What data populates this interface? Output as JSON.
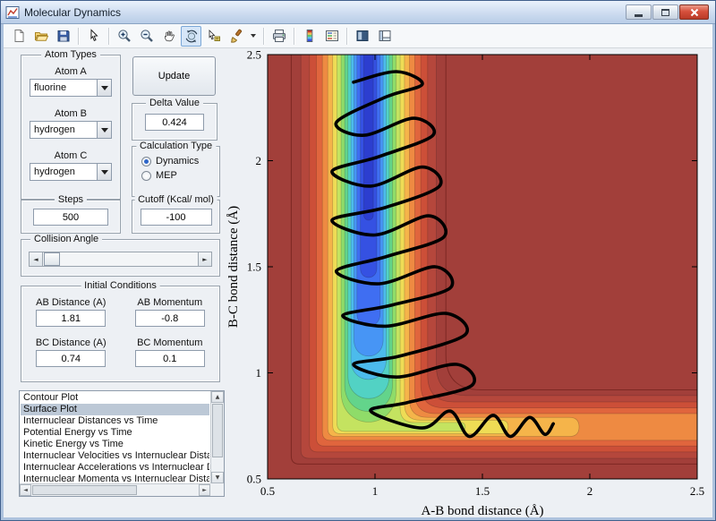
{
  "window": {
    "title": "Molecular Dynamics",
    "controls": [
      "minimize",
      "maximize",
      "close"
    ]
  },
  "toolbar": {
    "icons": [
      "new-figure",
      "open-file",
      "save-figure",
      "edit-plot",
      "zoom-in",
      "zoom-out",
      "pan",
      "rotate-3d",
      "data-cursor",
      "brush",
      "brush-dropdown",
      "print-figure",
      "insert-colorbar",
      "insert-legend",
      "hide-plot-tools",
      "show-plot-tools"
    ],
    "active_icon": "rotate-3d"
  },
  "panels": {
    "atom_types": {
      "title": "Atom Types",
      "fields": [
        {
          "label": "Atom A",
          "value": "fluorine"
        },
        {
          "label": "Atom B",
          "value": "hydrogen"
        },
        {
          "label": "Atom C",
          "value": "hydrogen"
        }
      ]
    },
    "update_button": {
      "label": "Update"
    },
    "delta": {
      "title": "Delta Value",
      "value": "0.424"
    },
    "calculation_type": {
      "title": "Calculation Type",
      "options": [
        {
          "label": "Dynamics",
          "selected": true
        },
        {
          "label": "MEP",
          "selected": false
        }
      ]
    },
    "steps": {
      "title": "Steps",
      "value": "500"
    },
    "cutoff": {
      "title": "Cutoff (Kcal/ mol)",
      "value": "-100"
    },
    "collision_angle": {
      "title": "Collision Angle"
    },
    "initial_conditions": {
      "title": "Initial Conditions",
      "fields": [
        {
          "label": "AB Distance (A)",
          "value": "1.81"
        },
        {
          "label": "AB Momentum",
          "value": "-0.8"
        },
        {
          "label": "BC Distance (A)",
          "value": "0.74"
        },
        {
          "label": "BC Momentum",
          "value": "0.1"
        }
      ]
    },
    "plot_list": {
      "items": [
        "Contour Plot",
        "Surface Plot",
        "Internuclear Distances vs Time",
        "Potential Energy vs Time",
        "Kinetic Energy vs Time",
        "Internuclear Velocities vs Internuclear Distance",
        "Internuclear Accelerations vs Internuclear Distance",
        "Internuclear Momenta vs Internuclear Distance"
      ],
      "selected_index": 1
    }
  },
  "chart_data": {
    "type": "contour",
    "xlabel": "A-B bond distance (Å)",
    "ylabel": "B-C bond distance (Å)",
    "xlim": [
      0.5,
      2.5
    ],
    "ylim": [
      0.5,
      2.5
    ],
    "xticks": [
      0.5,
      1,
      1.5,
      2,
      2.5
    ],
    "xtick_labels": [
      "0.5",
      "1",
      "1.5",
      "2",
      "2.5"
    ],
    "yticks": [
      0.5,
      1,
      1.5,
      2,
      2.5
    ],
    "ytick_labels": [
      "0.5",
      "1",
      "1.5",
      "2",
      "2.5"
    ],
    "description": "LEPS potential-energy-surface contour plot (jet colormap: dark red = high energy, blue = low energy valley) with a black quasiclassical trajectory oscillating down the vertical entrance channel and exiting along the horizontal product channel",
    "background_color": "#a23f3a",
    "valley": {
      "vertical_center_x": 0.97,
      "horizontal_center_y": 0.745,
      "outline": {
        "vw": 0.36,
        "hw": 0.175,
        "color": "rgba(100,25,20,0.6)"
      },
      "bands": [
        {
          "color": "#b5473c",
          "vw": 0.315,
          "hw": 0.148,
          "h_extent": 2.5,
          "v_bottom": 0
        },
        {
          "color": "#cc4f38",
          "vw": 0.275,
          "hw": 0.118,
          "h_extent": 2.5,
          "v_bottom": 0
        },
        {
          "color": "#e0653d",
          "vw": 0.243,
          "hw": 0.09,
          "h_extent": 2.5,
          "v_bottom": 0
        },
        {
          "color": "#ee8a42",
          "vw": 0.215,
          "hw": 0.063,
          "h_extent": 2.5,
          "v_bottom": 0
        },
        {
          "color": "#f5b44a",
          "vw": 0.19,
          "hw": 0.045,
          "h_extent": 1.95,
          "v_bottom": 0
        },
        {
          "color": "#eedc55",
          "vw": 0.167,
          "hw": 0.032,
          "h_extent": 1.62,
          "v_bottom": 0
        },
        {
          "color": "#c4e360",
          "vw": 0.147,
          "hw": 0.021,
          "h_extent": 1.42,
          "v_bottom": 0
        },
        {
          "color": "#8fdc69",
          "vw": 0.128,
          "hw": 0,
          "h_extent": 0,
          "v_bottom": 0.77
        },
        {
          "color": "#63d48b",
          "vw": 0.111,
          "hw": 0,
          "h_extent": 0,
          "v_bottom": 0.82
        },
        {
          "color": "#52d2c4",
          "vw": 0.096,
          "hw": 0,
          "h_extent": 0,
          "v_bottom": 0.88
        },
        {
          "color": "#4cbbec",
          "vw": 0.082,
          "hw": 0,
          "h_extent": 0,
          "v_bottom": 0.97
        },
        {
          "color": "#4795f5",
          "vw": 0.068,
          "hw": 0,
          "h_extent": 0,
          "v_bottom": 1.08
        },
        {
          "color": "#3f6ef2",
          "vw": 0.054,
          "hw": 0,
          "h_extent": 0,
          "v_bottom": 1.22
        },
        {
          "color": "#3551e2",
          "vw": 0.038,
          "hw": 0,
          "h_extent": 0,
          "v_bottom": 1.45
        },
        {
          "color": "#2c3ecf",
          "vw": 0.022,
          "hw": 0,
          "h_extent": 0,
          "v_bottom": 1.72
        }
      ]
    },
    "trajectory": {
      "color": "#000000",
      "width": 3.6,
      "points": [
        [
          0.9,
          2.37
        ],
        [
          1.1,
          2.42
        ],
        [
          1.22,
          2.36
        ],
        [
          1.05,
          2.3
        ],
        [
          0.82,
          2.18
        ],
        [
          0.95,
          2.12
        ],
        [
          1.18,
          2.2
        ],
        [
          1.27,
          2.12
        ],
        [
          1.02,
          2.02
        ],
        [
          0.8,
          1.95
        ],
        [
          0.98,
          1.88
        ],
        [
          1.22,
          1.97
        ],
        [
          1.3,
          1.88
        ],
        [
          1.05,
          1.78
        ],
        [
          0.8,
          1.72
        ],
        [
          1.0,
          1.65
        ],
        [
          1.25,
          1.74
        ],
        [
          1.32,
          1.64
        ],
        [
          1.06,
          1.55
        ],
        [
          0.82,
          1.48
        ],
        [
          1.02,
          1.42
        ],
        [
          1.28,
          1.5
        ],
        [
          1.35,
          1.4
        ],
        [
          1.08,
          1.32
        ],
        [
          0.85,
          1.27
        ],
        [
          1.05,
          1.22
        ],
        [
          1.33,
          1.28
        ],
        [
          1.42,
          1.18
        ],
        [
          1.12,
          1.08
        ],
        [
          0.9,
          1.04
        ],
        [
          1.1,
          0.98
        ],
        [
          1.38,
          1.04
        ],
        [
          1.45,
          0.94
        ],
        [
          1.15,
          0.86
        ],
        [
          0.98,
          0.82
        ],
        [
          1.22,
          0.74
        ],
        [
          1.35,
          0.82
        ],
        [
          1.44,
          0.7
        ],
        [
          1.55,
          0.8
        ],
        [
          1.63,
          0.7
        ],
        [
          1.72,
          0.79
        ],
        [
          1.79,
          0.71
        ],
        [
          1.83,
          0.76
        ]
      ]
    }
  }
}
